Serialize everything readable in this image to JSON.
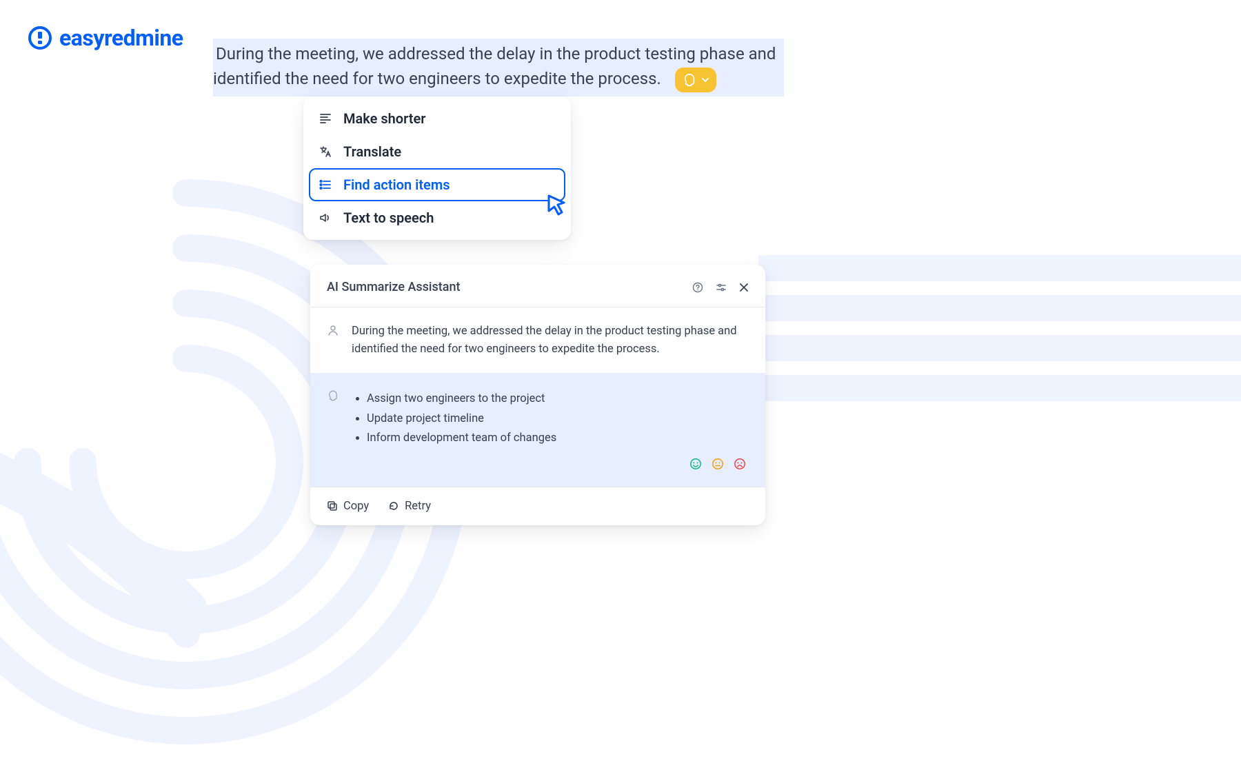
{
  "brand": {
    "name": "easyredmine",
    "color": "#005EFF"
  },
  "highlighted_text": "During the meeting, we addressed the delay in the product testing phase and identified the need for two engineers to expedite the process.",
  "ai_menu": {
    "items": [
      {
        "id": "make-shorter",
        "label": "Make shorter",
        "active": false
      },
      {
        "id": "translate",
        "label": "Translate",
        "active": false
      },
      {
        "id": "find-action-items",
        "label": "Find action items",
        "active": true
      },
      {
        "id": "text-to-speech",
        "label": "Text to speech",
        "active": false
      }
    ]
  },
  "assistant": {
    "title": "AI Summarize Assistant",
    "user_message": "During the meeting, we addressed the delay in the product testing phase and identified the need for two engineers to expedite the process.",
    "ai_response_items": [
      "Assign two engineers to the project",
      "Update project timeline",
      "Inform development team of changes"
    ],
    "actions": {
      "copy": "Copy",
      "retry": "Retry"
    }
  },
  "colors": {
    "feedback_happy": "#10B981",
    "feedback_neutral": "#F59E0B",
    "feedback_sad": "#EF4444"
  }
}
